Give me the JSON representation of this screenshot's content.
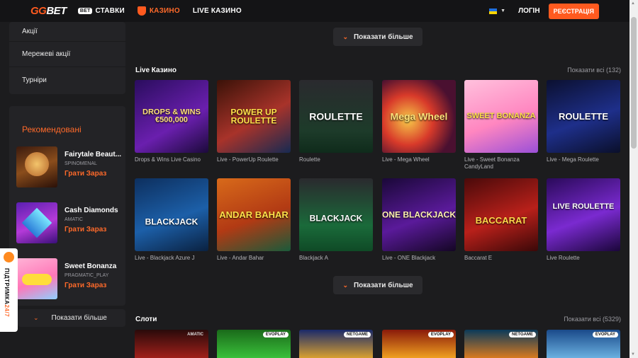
{
  "header": {
    "logo": "GGBET",
    "nav": [
      {
        "badge": "BET",
        "label": "СТАВКИ"
      },
      {
        "label": "КАЗИНО"
      },
      {
        "label": "LIVE КАЗИНО"
      }
    ],
    "login": "ЛОГІН",
    "register": "РЕЄСТРАЦІЯ"
  },
  "sidebar": {
    "promos": [
      "Акції",
      "Мережеві акції",
      "Турніри"
    ],
    "recommended_title": "Рекомендовані",
    "recommended": [
      {
        "name": "Fairytale Beaut...",
        "provider": "SPINOMENAL",
        "play": "Грати Зараз"
      },
      {
        "name": "Cash Diamonds",
        "provider": "AMATIC",
        "play": "Грати Зараз"
      },
      {
        "name": "Sweet Bonanza",
        "provider": "PRAGMATIC_PLAY",
        "play": "Грати Зараз"
      }
    ],
    "show_more": "Показати більше"
  },
  "support": {
    "label": "ПІДТРИМКА",
    "suffix": "24/7"
  },
  "main": {
    "show_more_top": "Показати більше",
    "live_title": "Live Казино",
    "live_show_all": "Показати всі (132)",
    "live_row1": [
      {
        "caption": "Drops & Wins Live Casino",
        "art": "DROPS & WINS €500,000"
      },
      {
        "caption": "Live - PowerUp Roulette",
        "art": "POWER UP ROULETTE"
      },
      {
        "caption": "Roulette",
        "art": "ROULETTE"
      },
      {
        "caption": "Live - Mega Wheel",
        "art": "Mega Wheel"
      },
      {
        "caption": "Live - Sweet Bonanza CandyLand",
        "art": "SWEET BONANZA"
      },
      {
        "caption": "Live - Mega Roulette",
        "art": "ROULETTE"
      }
    ],
    "live_row2": [
      {
        "caption": "Live - Blackjack Azure J",
        "art": "BLACKJACK"
      },
      {
        "caption": "Live - Andar Bahar",
        "art": "ANDAR BAHAR"
      },
      {
        "caption": "Blackjack A",
        "art": "BLACKJACK"
      },
      {
        "caption": "Live - ONE Blackjack",
        "art": "ONE BLACKJACK"
      },
      {
        "caption": "Baccarat E",
        "art": "BACCARAT"
      },
      {
        "caption": "Live Roulette",
        "art": "LIVE ROULETTE"
      }
    ],
    "show_more_mid": "Показати більше",
    "slots_title": "Слоти",
    "slots_show_all": "Показати всі (5329)",
    "slot_tags": [
      "AMATIC",
      "EVOPLAY",
      "NETGAME",
      "EVOPLAY",
      "NETGAME",
      "EVOPLAY"
    ]
  }
}
